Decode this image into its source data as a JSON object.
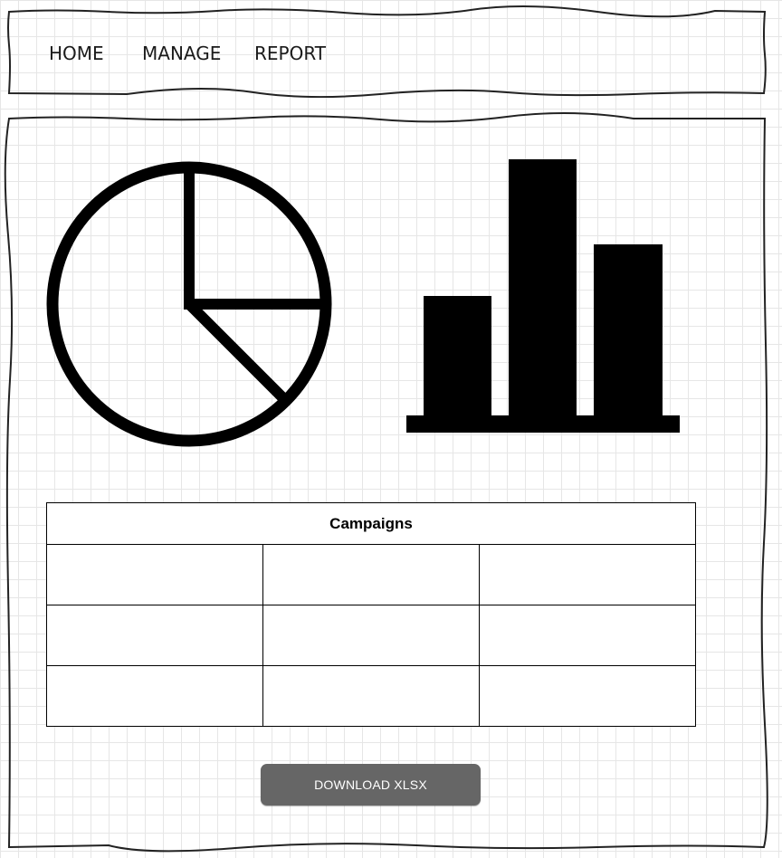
{
  "nav": {
    "items": [
      {
        "label": "HOME"
      },
      {
        "label": "MANAGE"
      },
      {
        "label": "REPORT"
      }
    ]
  },
  "icons": {
    "pie": "pie-chart-icon",
    "bar": "bar-chart-icon"
  },
  "table": {
    "title": "Campaigns",
    "rows": [
      [
        "",
        "",
        ""
      ],
      [
        "",
        "",
        ""
      ],
      [
        "",
        "",
        ""
      ]
    ]
  },
  "download": {
    "label": "DOWNLOAD XLSX"
  },
  "colors": {
    "ink": "#000000",
    "button": "#666666",
    "button_text": "#ffffff",
    "grid": "#e6e6e6"
  }
}
